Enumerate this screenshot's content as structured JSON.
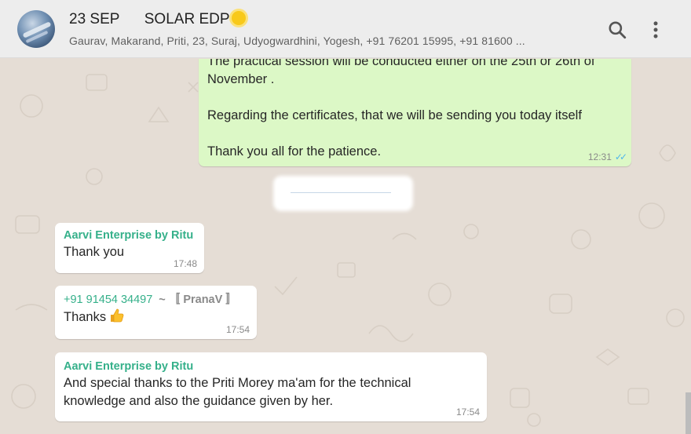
{
  "header": {
    "title": "23 SEP      SOLAR EDP",
    "participants": "Gaurav, Makarand, Priti, 23, Suraj, Udyogwardhini, Yogesh, +91 76201 15995, +91 81600 ...",
    "icons": {
      "search": "search-icon",
      "menu": "more-vertical-icon",
      "title_emoji": "sun-emoji"
    }
  },
  "messages": [
    {
      "direction": "outgoing",
      "text": "The practical session will be conducted either on the 25th or 26th of\nNovember .\n\nRegarding the certificates, that we will be sending you today itself\n\nThank you all for the patience.",
      "time": "12:31",
      "status": "read-double-tick"
    },
    {
      "direction": "incoming",
      "sender": "Aarvi Enterprise by Ritu",
      "text": "Thank you",
      "time": "17:48"
    },
    {
      "direction": "incoming",
      "sender_phone": "+91 91454 34497",
      "sender_alias": "~ 〚 PranaV 〛",
      "text": "Thanks",
      "emoji": "thumbs-up-emoji",
      "time": "17:54"
    },
    {
      "direction": "incoming",
      "sender": "Aarvi Enterprise by Ritu",
      "text": "And special thanks to the Priti Morey ma'am for the technical\nknowledge and also the guidance given by her.",
      "time": "17:54"
    }
  ],
  "colors": {
    "header_bg": "#ededed",
    "chat_bg": "#e5ddd5",
    "outgoing_bubble": "#dcf8c6",
    "incoming_bubble": "#ffffff",
    "sender_name": "#35b08a",
    "read_ticks": "#4fb6ec"
  }
}
